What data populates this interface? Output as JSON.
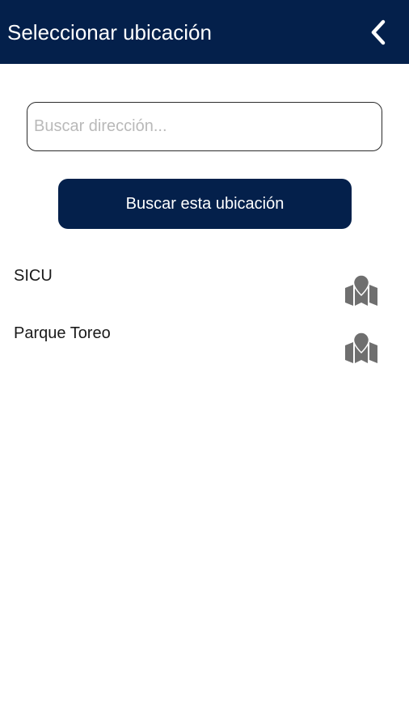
{
  "header": {
    "title": "Seleccionar ubicación",
    "back_icon": "chevron-left-icon"
  },
  "search": {
    "placeholder": "Buscar dirección...",
    "value": "",
    "button_label": "Buscar esta ubicación"
  },
  "locations": [
    {
      "label": "SICU",
      "icon": "map-pin-icon"
    },
    {
      "label": "Parque Toreo",
      "icon": "map-pin-icon"
    }
  ],
  "colors": {
    "primary": "#04204b",
    "icon": "#6f6f6f"
  }
}
